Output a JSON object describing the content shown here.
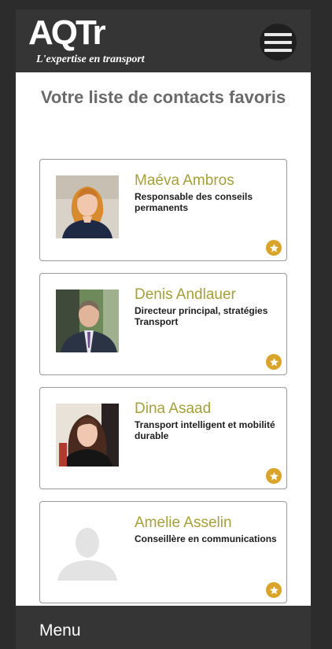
{
  "header": {
    "logo_text": "AQTr",
    "tagline": "L'expertise en transport",
    "menu_icon": "hamburger-icon"
  },
  "page": {
    "title": "Votre liste de contacts favoris"
  },
  "contacts": [
    {
      "name": "Maéva Ambros",
      "role": "Responsable des conseils permanents",
      "favorite": true
    },
    {
      "name": "Denis Andlauer",
      "role": "Directeur principal, stratégies Transport",
      "favorite": true
    },
    {
      "name": "Dina Asaad",
      "role": "Transport intelligent et mobilité durable",
      "favorite": true
    },
    {
      "name": "Amelie Asselin",
      "role": "Conseillère en communications",
      "favorite": true
    }
  ],
  "footer": {
    "menu_label": "Menu"
  },
  "colors": {
    "accent_name": "#a5a03c",
    "favorite_star": "#d8a52a",
    "chrome_dark": "#353535",
    "title_gray": "#6a6a6a"
  }
}
